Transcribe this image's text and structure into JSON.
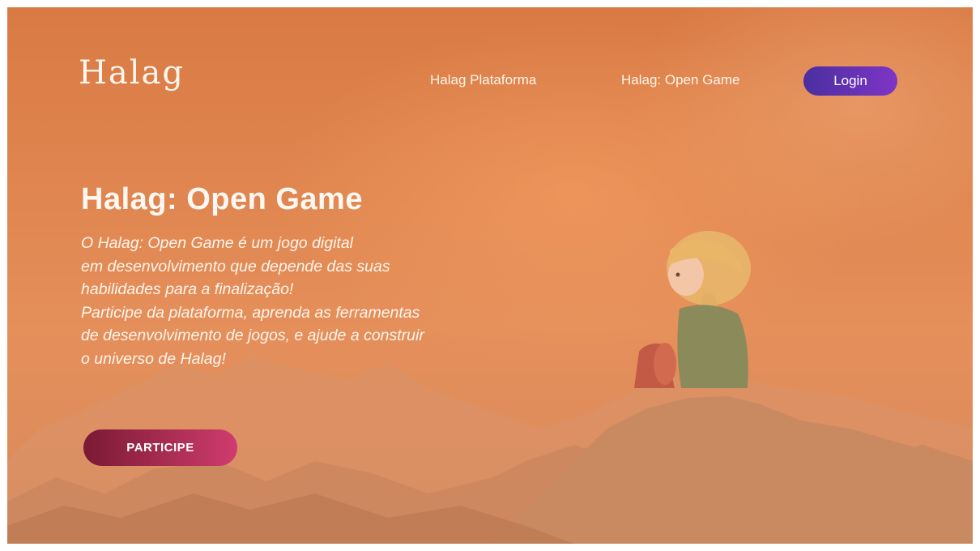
{
  "brand": {
    "logo_text": "Halag"
  },
  "nav": {
    "links": [
      {
        "label": "Halag Plataforma"
      },
      {
        "label": "Halag: Open Game"
      }
    ],
    "login_label": "Login"
  },
  "hero": {
    "title": "Halag: Open Game",
    "description_lines": [
      "O Halag: Open Game é um jogo digital",
      "em desenvolvimento que depende das suas",
      "habilidades para a finalização!",
      "Participe da plataforma, aprenda as ferramentas",
      "de desenvolvimento de jogos, e ajude a construir",
      "o universo de Halag!"
    ],
    "cta_label": "PARTICIPE"
  },
  "background": {
    "illustration": "watercolor-mountains-with-sitting-child",
    "colors": {
      "sky": "#e08650",
      "mountains": "#c98a62",
      "login_button": "#5a32b0",
      "cta_button": "#b8325f"
    }
  }
}
